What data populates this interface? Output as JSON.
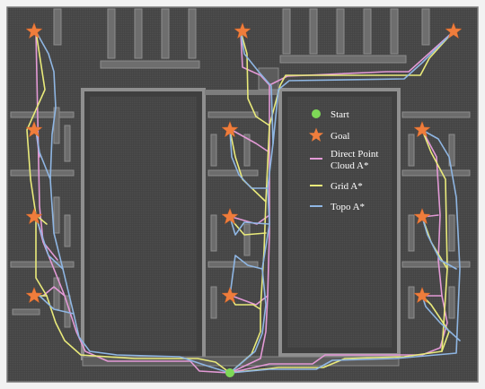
{
  "legend": {
    "start": "Start",
    "goal": "Goal",
    "direct": "Direct Point Cloud A*",
    "direct_line1": "Direct Point",
    "direct_line2": "Cloud A*",
    "grid": "Grid A*",
    "topo": "Topo A*"
  },
  "colors": {
    "background": "#4b4b4b",
    "walls": "#8a8a8a",
    "start": "#7ed957",
    "goal": "#ef7d3c",
    "direct": "#e39ad6",
    "grid": "#e9ea7a",
    "topo": "#8fb6e3"
  },
  "icons": {
    "start": "green-circle",
    "goal": "orange-star"
  },
  "goal_count": 12
}
